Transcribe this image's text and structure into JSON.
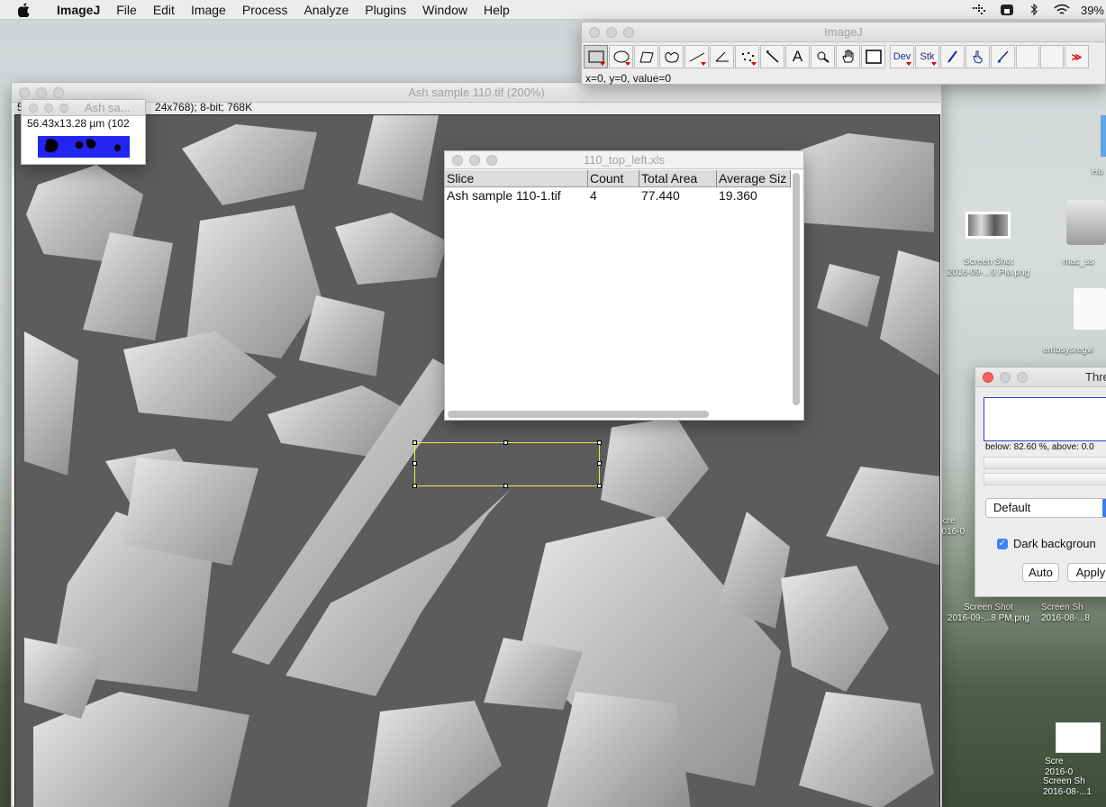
{
  "menubar": {
    "app_name": "ImageJ",
    "items": [
      "File",
      "Edit",
      "Image",
      "Process",
      "Analyze",
      "Plugins",
      "Window",
      "Help"
    ],
    "battery": "39%"
  },
  "toolbar": {
    "title": "ImageJ",
    "tools": [
      "rectangle-tool",
      "oval-tool",
      "polygon-tool",
      "freehand-tool",
      "line-tool",
      "angle-tool",
      "point-tool",
      "wand-tool",
      "text-tool",
      "magnifier-tool",
      "hand-tool",
      "color-picker-tool",
      "dev-tool",
      "stk-tool",
      "brush-tool",
      "hand-pointer-tool",
      "pencil-tool",
      "blank-1",
      "blank-2",
      "more-tools"
    ],
    "dev_label": "Dev",
    "stk_label": "Stk",
    "text_label": "A",
    "more_label": "≫",
    "status": "x=0, y=0, value=0"
  },
  "image_window": {
    "title": "Ash sample 110.tif (200%)",
    "info_prefix": "5",
    "info": "24x768); 8-bit; 768K"
  },
  "mask_window": {
    "title": "Ash sa...",
    "info": "56.43x13.28 µm (102"
  },
  "results_table": {
    "title": "110_top_left.xls",
    "columns": [
      "Slice",
      "Count",
      "Total Area",
      "Average Siz"
    ],
    "rows": [
      [
        "Ash sample 110-1.tif",
        "4",
        "77.440",
        "19.360"
      ]
    ]
  },
  "threshold": {
    "title": "Thre",
    "stats": "below: 82.60 %,  above: 0.0",
    "method": "Default",
    "dark_background_label": "Dark backgroun",
    "dark_background_checked": true,
    "auto_label": "Auto",
    "apply_label": "Apply"
  },
  "desktop": {
    "icons": [
      {
        "line1": "Screen Shot",
        "line2": "2016-09-...9 PM.png"
      },
      {
        "line1": "mac_ss",
        "line2": ""
      },
      {
        "line1": "embsysregvi",
        "line2": ""
      },
      {
        "line1": "Ho",
        "line2": ""
      },
      {
        "line1": "Scre",
        "line2": "2016-0"
      },
      {
        "line1": "Screen Shot",
        "line2": "2016-09-...8 PM.png"
      },
      {
        "line1": "Screen Sh",
        "line2": "2016-08-...8"
      },
      {
        "line1": "Scre",
        "line2": "2016-0"
      },
      {
        "line1": "Screen Sh",
        "line2": "2016-08-...1"
      }
    ]
  }
}
